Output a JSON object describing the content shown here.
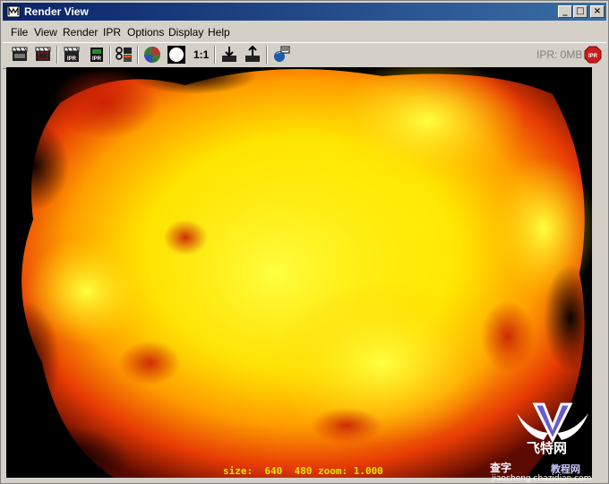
{
  "window": {
    "title": "Render View",
    "icon": "render-view-app-icon",
    "controls": [
      "_",
      "□",
      "×"
    ]
  },
  "menu": [
    "File",
    "View",
    "Render",
    "IPR",
    "Options",
    "Display",
    "Help"
  ],
  "toolbar": {
    "buttons": [
      "redo-previous-render-icon",
      "render-region-icon",
      "ipr-render-icon",
      "ipr-refresh-icon",
      "render-settings-icon",
      "display-rgb-channels-icon",
      "display-alpha-channel-icon",
      "keep-image-icon",
      "remove-image-icon",
      "render-diagnostics-icon"
    ],
    "ratio_label": "1:1",
    "ipr_memory": "IPR: 0MB",
    "stop_icon": "ipr-stop-icon",
    "stop_label": "IPR"
  },
  "viewport": {
    "status": "size:  640  480 zoom: 1.000",
    "image": "fire-explosion-render"
  },
  "watermark": {
    "brand": "飞特网",
    "sub_left": "查字",
    "sub_right": "教程网",
    "url": "jiaocheng.chazidian.com"
  },
  "colors": {
    "titlebar_start": "#0a246a",
    "titlebar_end": "#3a6ea5",
    "chrome": "#d4d0c8",
    "status_text": "#e6e600",
    "fire_core": "#ffff00",
    "fire_mid": "#ff8c00",
    "fire_edge": "#d81e05"
  }
}
